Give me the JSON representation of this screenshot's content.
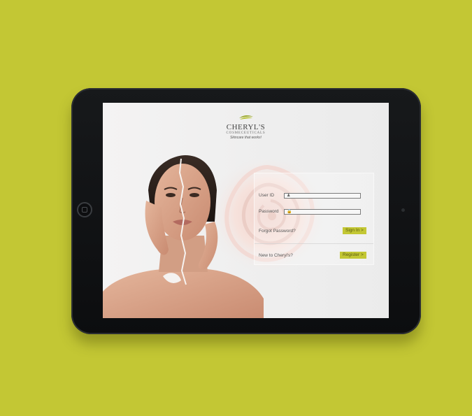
{
  "logo": {
    "name": "CHERYL'S",
    "subtitle": "COSMECEUTICALS",
    "tagline": "Skincare that works!"
  },
  "login": {
    "user_id_label": "User ID",
    "password_label": "Password",
    "forgot_password": "Forgot Password?",
    "sign_in_label": "Sign In >",
    "new_user_label": "New to Cheryl's?",
    "register_label": "Register >"
  },
  "colors": {
    "background": "#c3c734",
    "accent": "#c3c734",
    "device": "#0c0d0f"
  },
  "icons": {
    "user_field": "user-icon",
    "password_field": "lock-icon"
  }
}
